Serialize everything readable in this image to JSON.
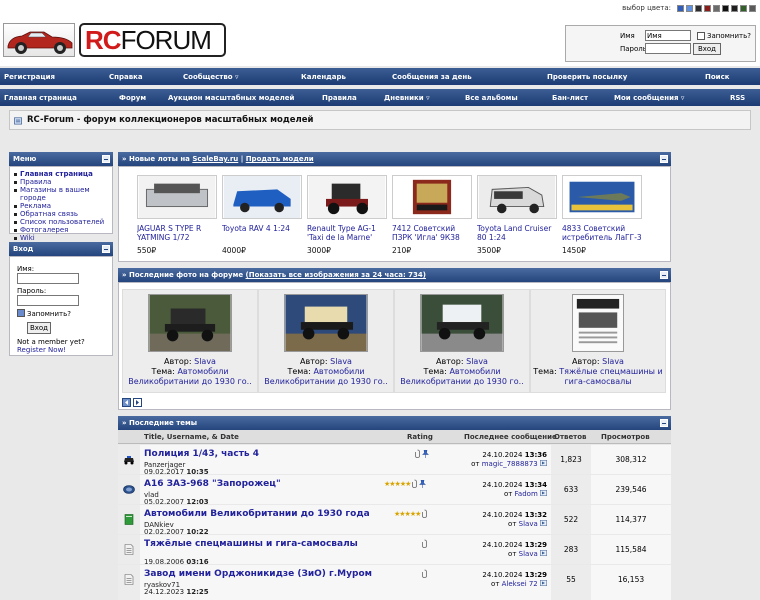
{
  "header": {
    "color_picker_label": "выбор цвета:",
    "color_swatches": [
      "#2f5dbb",
      "#5e91e2",
      "#2c2c2c",
      "#8b1c1c",
      "#6b6b6b",
      "#111111",
      "#1f1f1f",
      "#335f2a",
      "#5a5a5a"
    ],
    "logo_rc": "RC",
    "logo_forum": "FORUM",
    "login": {
      "username_label": "Имя",
      "username_value": "Имя",
      "password_label": "Пароль",
      "remember_label": "Запомнить?",
      "submit_label": "Вход"
    }
  },
  "nav1": [
    "Регистрация",
    "Справка",
    "Сообщество ▿",
    "Календарь",
    "Сообщения за день",
    "Проверить посылку",
    "Поиск"
  ],
  "nav2": [
    "Главная страница",
    "Форум",
    "Аукцион масштабных моделей",
    "Правила",
    "Дневники ▿",
    "Все альбомы",
    "Бан-лист",
    "Мои сообщения ▿",
    "RSS"
  ],
  "page_title": "RC-Forum - форум коллекционеров масштабных моделей",
  "menu": {
    "title": "Меню",
    "items": [
      "Главная страница",
      "Правила",
      "Магазины в вашем городе",
      "Реклама",
      "Обратная связь",
      "Список пользователей",
      "Фотогалерея",
      "Wiki"
    ]
  },
  "login_panel": {
    "title": "Вход",
    "username_label": "Имя:",
    "password_label": "Пароль:",
    "remember_label": "Запомнить?",
    "submit_label": "Вход",
    "not_member": "Not a member yet?",
    "register_link": "Register Now!"
  },
  "lots": {
    "title_prefix": "» Новые лоты на",
    "site_link": "ScaleBay.ru",
    "separator": "|",
    "sell_link": "Продать модели",
    "items": [
      {
        "name": "JAGUAR S TYPE R YATMING 1/72",
        "price": "550₽"
      },
      {
        "name": "Toyota RAV 4 1:24",
        "price": "4000₽"
      },
      {
        "name": "Renault Type AG-1 'Taxi de la Marne'",
        "price": "3000₽"
      },
      {
        "name": "7412 Советский ПЗРК 'Игла' 9К38",
        "price": "210₽"
      },
      {
        "name": "Toyota Land Cruiser 80 1:24",
        "price": "3500₽"
      },
      {
        "name": "4833 Советский истребитель ЛаГГ-3",
        "price": "1450₽"
      }
    ]
  },
  "photos": {
    "title_prefix": "» Последние фото на форуме",
    "show_all": "(Показать все изображения за 24 часа: 734)",
    "author_label": "Автор:",
    "topic_label": "Тема:",
    "items": [
      {
        "author": "Slava",
        "topic": "Автомобили Великобритании до 1930 го.."
      },
      {
        "author": "Slava",
        "topic": "Автомобили Великобритании до 1930 го.."
      },
      {
        "author": "Slava",
        "topic": "Автомобили Великобритании до 1930 го.."
      },
      {
        "author": "Slava",
        "topic": "Тяжёлые спецмашины и гига-самосвалы"
      }
    ]
  },
  "topics": {
    "title": "» Последние темы",
    "columns": {
      "title": "Title, Username, & Date",
      "rating": "Rating",
      "last": "Последнее сообщение",
      "replies": "Ответов",
      "views": "Просмотров"
    },
    "rows": [
      {
        "title": "Полиция 1/43, часть 4",
        "author": "Panzerjager",
        "date": "09.02.2017",
        "time": "10:35",
        "stars": "",
        "last_date": "24.10.2024",
        "last_time": "13:36",
        "last_by": "magic_7888873",
        "replies": "1,823",
        "views": "308,312"
      },
      {
        "title": "А16 ЗАЗ-968 \"Запорожец\"",
        "author": "vlad",
        "date": "05.02.2007",
        "time": "12:03",
        "stars": "★★★★★",
        "last_date": "24.10.2024",
        "last_time": "13:34",
        "last_by": "Fadom",
        "replies": "633",
        "views": "239,546"
      },
      {
        "title": "Автомобили Великобритании до 1930 года",
        "author": "DANkiev",
        "date": "02.02.2007",
        "time": "10:22",
        "stars": "★★★★★",
        "last_date": "24.10.2024",
        "last_time": "13:32",
        "last_by": "Slava",
        "replies": "522",
        "views": "114,377"
      },
      {
        "title": "Тяжёлые спецмашины и гига-самосвалы",
        "author": "",
        "date": "19.08.2006",
        "time": "03:16",
        "stars": "",
        "last_date": "24.10.2024",
        "last_time": "13:29",
        "last_by": "Slava",
        "replies": "283",
        "views": "115,584"
      },
      {
        "title": "Завод имени Орджоникидзе (ЗиО) г.Муром",
        "author": "ryaskov71",
        "date": "24.12.2023",
        "time": "12:25",
        "stars": "",
        "last_date": "24.10.2024",
        "last_time": "13:29",
        "last_by": "Aleksei 72",
        "replies": "55",
        "views": "16,153"
      }
    ]
  },
  "by_label": "от"
}
